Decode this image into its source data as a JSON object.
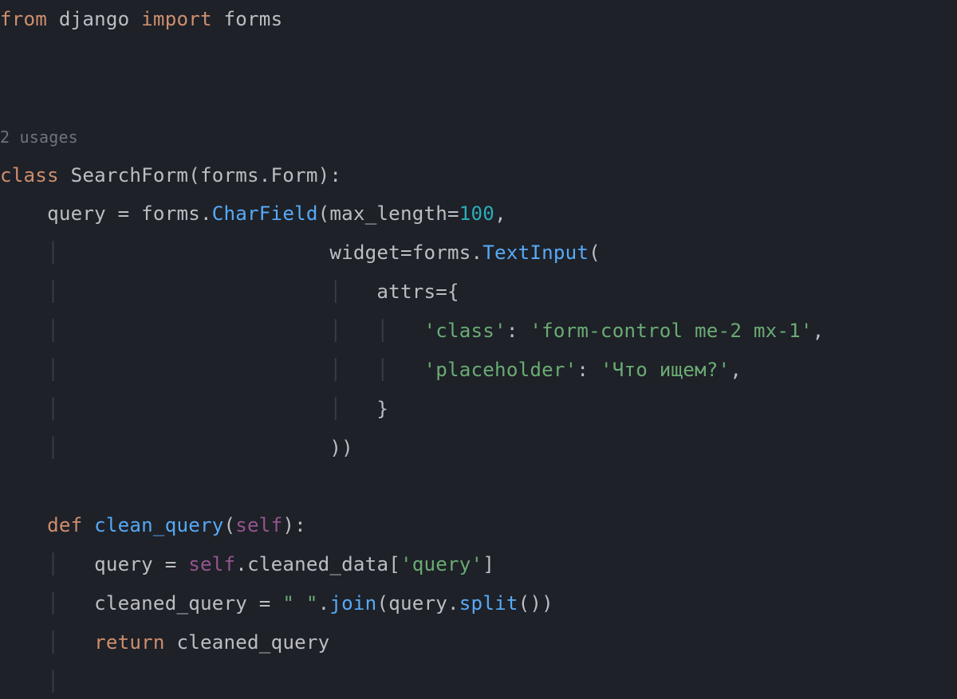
{
  "code": {
    "hint_above_class": "2 usages",
    "lines": [
      {
        "segments": [
          {
            "t": "from",
            "c": "kw"
          },
          {
            "t": " ",
            "c": "id"
          },
          {
            "t": "django",
            "c": "id"
          },
          {
            "t": " ",
            "c": "id"
          },
          {
            "t": "import",
            "c": "kw"
          },
          {
            "t": " ",
            "c": "id"
          },
          {
            "t": "forms",
            "c": "id"
          }
        ]
      },
      {
        "segments": []
      },
      {
        "segments": []
      },
      {
        "hint": true
      },
      {
        "segments": [
          {
            "t": "class ",
            "c": "kw"
          },
          {
            "t": "SearchForm",
            "c": "id"
          },
          {
            "t": "(",
            "c": "op"
          },
          {
            "t": "forms",
            "c": "id"
          },
          {
            "t": ".",
            "c": "op"
          },
          {
            "t": "Form",
            "c": "id"
          },
          {
            "t": "):",
            "c": "op"
          }
        ]
      },
      {
        "indent": 1,
        "segments": [
          {
            "t": "query ",
            "c": "id"
          },
          {
            "t": "= ",
            "c": "op"
          },
          {
            "t": "forms",
            "c": "id"
          },
          {
            "t": ".",
            "c": "op"
          },
          {
            "t": "CharField",
            "c": "fn"
          },
          {
            "t": "(",
            "c": "op"
          },
          {
            "t": "max_length",
            "c": "id"
          },
          {
            "t": "=",
            "c": "op"
          },
          {
            "t": "100",
            "c": "num"
          },
          {
            "t": ",",
            "c": "op"
          }
        ]
      },
      {
        "indent_spaces": 28,
        "guide_cols": [
          4,
          28
        ],
        "segments": [
          {
            "t": "widget",
            "c": "id"
          },
          {
            "t": "=",
            "c": "op"
          },
          {
            "t": "forms",
            "c": "id"
          },
          {
            "t": ".",
            "c": "op"
          },
          {
            "t": "TextInput",
            "c": "fn"
          },
          {
            "t": "(",
            "c": "op"
          }
        ]
      },
      {
        "indent_spaces": 32,
        "guide_cols": [
          4,
          28,
          32
        ],
        "segments": [
          {
            "t": "attrs",
            "c": "id"
          },
          {
            "t": "=",
            "c": "op"
          },
          {
            "t": "{",
            "c": "op"
          }
        ]
      },
      {
        "indent_spaces": 36,
        "guide_cols": [
          4,
          28,
          32,
          36
        ],
        "segments": [
          {
            "t": "'class'",
            "c": "str"
          },
          {
            "t": ": ",
            "c": "op"
          },
          {
            "t": "'form-control me-2 mx-1'",
            "c": "str"
          },
          {
            "t": ",",
            "c": "op"
          }
        ]
      },
      {
        "indent_spaces": 36,
        "guide_cols": [
          4,
          28,
          32,
          36
        ],
        "segments": [
          {
            "t": "'placeholder'",
            "c": "str"
          },
          {
            "t": ": ",
            "c": "op"
          },
          {
            "t": "'Что ищем?'",
            "c": "str"
          },
          {
            "t": ",",
            "c": "op"
          }
        ]
      },
      {
        "indent_spaces": 32,
        "guide_cols": [
          4,
          28,
          32
        ],
        "segments": [
          {
            "t": "}",
            "c": "op"
          }
        ]
      },
      {
        "indent_spaces": 28,
        "guide_cols": [
          4,
          28
        ],
        "segments": [
          {
            "t": "))",
            "c": "op"
          }
        ]
      },
      {
        "indent": 1,
        "guide_cols": [
          4
        ],
        "segments": []
      },
      {
        "indent": 1,
        "guide_cols": [
          4
        ],
        "segments": [
          {
            "t": "def ",
            "c": "kw"
          },
          {
            "t": "clean_query",
            "c": "fndef"
          },
          {
            "t": "(",
            "c": "op"
          },
          {
            "t": "self",
            "c": "self"
          },
          {
            "t": "):",
            "c": "op"
          }
        ]
      },
      {
        "indent": 2,
        "guide_cols": [
          4,
          8
        ],
        "segments": [
          {
            "t": "query ",
            "c": "id"
          },
          {
            "t": "= ",
            "c": "op"
          },
          {
            "t": "self",
            "c": "self"
          },
          {
            "t": ".",
            "c": "op"
          },
          {
            "t": "cleaned_data",
            "c": "id"
          },
          {
            "t": "[",
            "c": "op"
          },
          {
            "t": "'query'",
            "c": "str"
          },
          {
            "t": "]",
            "c": "op"
          }
        ]
      },
      {
        "indent": 2,
        "guide_cols": [
          4,
          8
        ],
        "segments": [
          {
            "t": "cleaned_query ",
            "c": "id"
          },
          {
            "t": "= ",
            "c": "op"
          },
          {
            "t": "\" \"",
            "c": "str"
          },
          {
            "t": ".",
            "c": "op"
          },
          {
            "t": "join",
            "c": "fn"
          },
          {
            "t": "(",
            "c": "op"
          },
          {
            "t": "query",
            "c": "id"
          },
          {
            "t": ".",
            "c": "op"
          },
          {
            "t": "split",
            "c": "fn"
          },
          {
            "t": "())",
            "c": "op"
          }
        ]
      },
      {
        "indent": 2,
        "guide_cols": [
          4,
          8
        ],
        "segments": [
          {
            "t": "return ",
            "c": "kw"
          },
          {
            "t": "cleaned_query",
            "c": "id"
          }
        ]
      },
      {
        "indent": 2,
        "guide_cols": [
          4,
          8
        ],
        "segments": []
      }
    ]
  },
  "colors": {
    "bg": "#1e2128",
    "fg": "#bcbec4",
    "keyword": "#cf8e6d",
    "function": "#57aaf7",
    "self": "#94558d",
    "number": "#2aacb8",
    "string": "#6aab73",
    "hint": "#6f737a",
    "guide": "#3a3d44"
  }
}
